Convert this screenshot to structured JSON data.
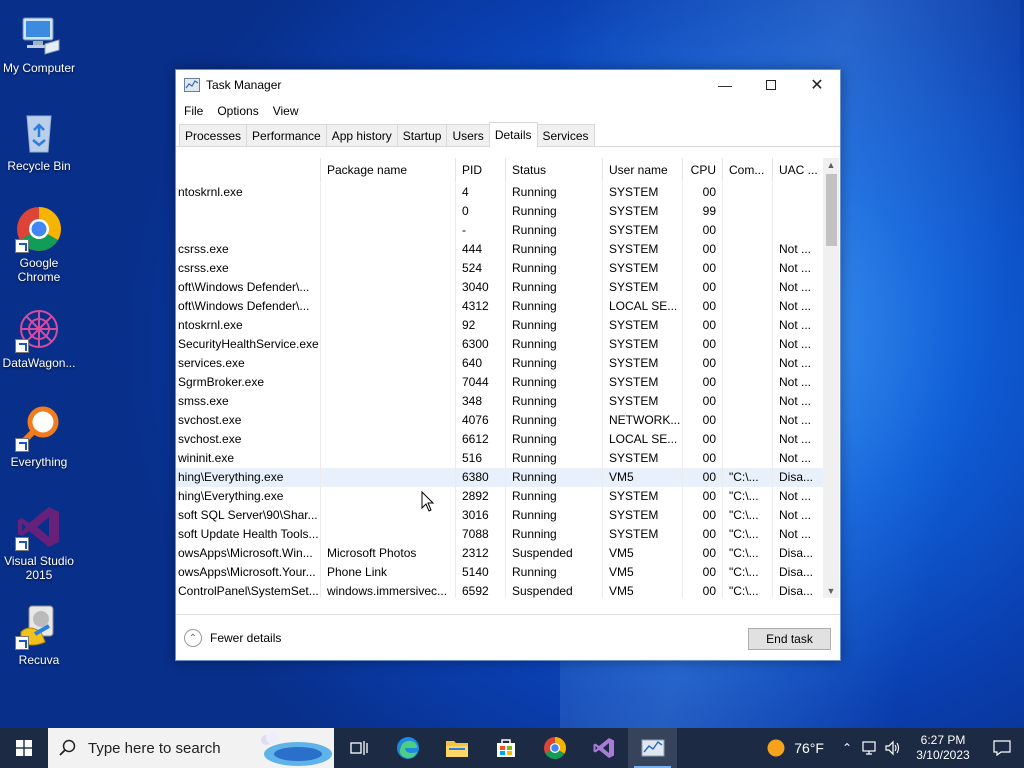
{
  "desktop": {
    "icons": [
      {
        "label": "My Computer"
      },
      {
        "label": "Recycle Bin"
      },
      {
        "label": "Google Chrome"
      },
      {
        "label": "DataWagon..."
      },
      {
        "label": "Everything"
      },
      {
        "label": "Visual Studio 2015"
      },
      {
        "label": "Recuva"
      }
    ]
  },
  "window": {
    "title": "Task Manager",
    "menu": [
      "File",
      "Options",
      "View"
    ],
    "tabs": [
      "Processes",
      "Performance",
      "App history",
      "Startup",
      "Users",
      "Details",
      "Services"
    ],
    "active_tab": "Details",
    "columns": [
      "",
      "Package name",
      "PID",
      "Status",
      "User name",
      "CPU",
      "Com...",
      "UAC ..."
    ],
    "rows": [
      {
        "name": "ntoskrnl.exe",
        "pkg": "",
        "pid": "4",
        "status": "Running",
        "user": "SYSTEM",
        "cpu": "00",
        "cmd": "",
        "uac": ""
      },
      {
        "name": "",
        "pkg": "",
        "pid": "0",
        "status": "Running",
        "user": "SYSTEM",
        "cpu": "99",
        "cmd": "",
        "uac": ""
      },
      {
        "name": "",
        "pkg": "",
        "pid": "-",
        "status": "Running",
        "user": "SYSTEM",
        "cpu": "00",
        "cmd": "",
        "uac": ""
      },
      {
        "name": "csrss.exe",
        "pkg": "",
        "pid": "444",
        "status": "Running",
        "user": "SYSTEM",
        "cpu": "00",
        "cmd": "",
        "uac": "Not ..."
      },
      {
        "name": "csrss.exe",
        "pkg": "",
        "pid": "524",
        "status": "Running",
        "user": "SYSTEM",
        "cpu": "00",
        "cmd": "",
        "uac": "Not ..."
      },
      {
        "name": "oft\\Windows Defender\\...",
        "pkg": "",
        "pid": "3040",
        "status": "Running",
        "user": "SYSTEM",
        "cpu": "00",
        "cmd": "",
        "uac": "Not ..."
      },
      {
        "name": "oft\\Windows Defender\\...",
        "pkg": "",
        "pid": "4312",
        "status": "Running",
        "user": "LOCAL SE...",
        "cpu": "00",
        "cmd": "",
        "uac": "Not ..."
      },
      {
        "name": "ntoskrnl.exe",
        "pkg": "",
        "pid": "92",
        "status": "Running",
        "user": "SYSTEM",
        "cpu": "00",
        "cmd": "",
        "uac": "Not ..."
      },
      {
        "name": "SecurityHealthService.exe",
        "pkg": "",
        "pid": "6300",
        "status": "Running",
        "user": "SYSTEM",
        "cpu": "00",
        "cmd": "",
        "uac": "Not ..."
      },
      {
        "name": "services.exe",
        "pkg": "",
        "pid": "640",
        "status": "Running",
        "user": "SYSTEM",
        "cpu": "00",
        "cmd": "",
        "uac": "Not ..."
      },
      {
        "name": "SgrmBroker.exe",
        "pkg": "",
        "pid": "7044",
        "status": "Running",
        "user": "SYSTEM",
        "cpu": "00",
        "cmd": "",
        "uac": "Not ..."
      },
      {
        "name": "smss.exe",
        "pkg": "",
        "pid": "348",
        "status": "Running",
        "user": "SYSTEM",
        "cpu": "00",
        "cmd": "",
        "uac": "Not ..."
      },
      {
        "name": "svchost.exe",
        "pkg": "",
        "pid": "4076",
        "status": "Running",
        "user": "NETWORK...",
        "cpu": "00",
        "cmd": "",
        "uac": "Not ..."
      },
      {
        "name": "svchost.exe",
        "pkg": "",
        "pid": "6612",
        "status": "Running",
        "user": "LOCAL SE...",
        "cpu": "00",
        "cmd": "",
        "uac": "Not ..."
      },
      {
        "name": "wininit.exe",
        "pkg": "",
        "pid": "516",
        "status": "Running",
        "user": "SYSTEM",
        "cpu": "00",
        "cmd": "",
        "uac": "Not ..."
      },
      {
        "name": "hing\\Everything.exe",
        "pkg": "",
        "pid": "6380",
        "status": "Running",
        "user": "VM5",
        "cpu": "00",
        "cmd": "\"C:\\...",
        "uac": "Disa...",
        "selected": true
      },
      {
        "name": "hing\\Everything.exe",
        "pkg": "",
        "pid": "2892",
        "status": "Running",
        "user": "SYSTEM",
        "cpu": "00",
        "cmd": "\"C:\\...",
        "uac": "Not ..."
      },
      {
        "name": "soft SQL Server\\90\\Shar...",
        "pkg": "",
        "pid": "3016",
        "status": "Running",
        "user": "SYSTEM",
        "cpu": "00",
        "cmd": "\"C:\\...",
        "uac": "Not ..."
      },
      {
        "name": "soft Update Health Tools...",
        "pkg": "",
        "pid": "7088",
        "status": "Running",
        "user": "SYSTEM",
        "cpu": "00",
        "cmd": "\"C:\\...",
        "uac": "Not ..."
      },
      {
        "name": "owsApps\\Microsoft.Win...",
        "pkg": "Microsoft Photos",
        "pid": "2312",
        "status": "Suspended",
        "user": "VM5",
        "cpu": "00",
        "cmd": "\"C:\\...",
        "uac": "Disa..."
      },
      {
        "name": "owsApps\\Microsoft.Your...",
        "pkg": "Phone Link",
        "pid": "5140",
        "status": "Running",
        "user": "VM5",
        "cpu": "00",
        "cmd": "\"C:\\...",
        "uac": "Disa..."
      },
      {
        "name": "ControlPanel\\SystemSet...",
        "pkg": "windows.immersivec...",
        "pid": "6592",
        "status": "Suspended",
        "user": "VM5",
        "cpu": "00",
        "cmd": "\"C:\\...",
        "uac": "Disa..."
      }
    ],
    "fewer_details": "Fewer details",
    "end_task": "End task"
  },
  "taskbar": {
    "search_placeholder": "Type here to search",
    "weather": "76°F",
    "time": "6:27 PM",
    "date": "3/10/2023"
  },
  "colors": {
    "accent": "#0078d7",
    "selected_row": "#e8f1fb",
    "taskbar": "#1c2a44"
  }
}
